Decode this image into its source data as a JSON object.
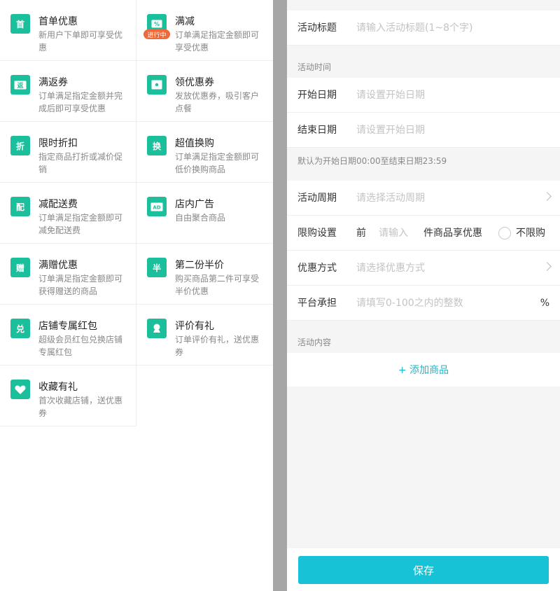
{
  "activities": [
    {
      "title": "首单优惠",
      "desc": "新用户下单即可享受优惠",
      "icon": "first-order-icon",
      "glyph": "首"
    },
    {
      "title": "满减",
      "desc": "订单满足指定金额即可享受优惠",
      "icon": "percent-tag-icon",
      "glyph": "%",
      "badge": "进行中"
    },
    {
      "title": "满返券",
      "desc": "订单满足指定金额并完成后即可享受优惠",
      "icon": "return-coupon-icon",
      "glyph": "返"
    },
    {
      "title": "领优惠券",
      "desc": "发放优惠券，吸引客户点餐",
      "icon": "coupon-icon",
      "glyph": "券"
    },
    {
      "title": "限时折扣",
      "desc": "指定商品打折或减价促销",
      "icon": "discount-icon",
      "glyph": "折"
    },
    {
      "title": "超值换购",
      "desc": "订单满足指定金额即可低价换购商品",
      "icon": "exchange-icon",
      "glyph": "换"
    },
    {
      "title": "减配送费",
      "desc": "订单满足指定金额即可减免配送费",
      "icon": "delivery-fee-icon",
      "glyph": "配"
    },
    {
      "title": "店内广告",
      "desc": "自由聚合商品",
      "icon": "ad-icon",
      "glyph": "AD"
    },
    {
      "title": "满赠优惠",
      "desc": "订单满足指定金额即可获得赠送的商品",
      "icon": "gift-icon",
      "glyph": "赠"
    },
    {
      "title": "第二份半价",
      "desc": "购买商品第二件可享受半价优惠",
      "icon": "half-price-icon",
      "glyph": "半"
    },
    {
      "title": "店铺专属红包",
      "desc": "超级会员红包兑换店铺专属红包",
      "icon": "red-packet-icon",
      "glyph": "兑"
    },
    {
      "title": "评价有礼",
      "desc": "订单评价有礼，送优惠券",
      "icon": "review-gift-icon",
      "glyph": ""
    },
    {
      "title": "收藏有礼",
      "desc": "首次收藏店铺，送优惠券",
      "icon": "heart-icon",
      "glyph": ""
    }
  ],
  "form": {
    "title_label": "活动标题",
    "title_placeholder": "请输入活动标题(1~8个字)",
    "time_section": "活动时间",
    "start_label": "开始日期",
    "start_placeholder": "请设置开始日期",
    "end_label": "结束日期",
    "end_placeholder": "请设置开始日期",
    "time_hint": "默认为开始日期00:00至结束日期23:59",
    "cycle_label": "活动周期",
    "cycle_placeholder": "请选择活动周期",
    "limit_label": "限购设置",
    "limit_prefix": "前",
    "limit_placeholder": "请输入",
    "limit_suffix": "件商品享优惠",
    "no_limit_label": "不限购",
    "discount_label": "优惠方式",
    "discount_placeholder": "请选择优惠方式",
    "platform_label": "平台承担",
    "platform_placeholder": "请填写0-100之内的整数",
    "platform_unit": "%",
    "content_section": "活动内容",
    "add_product": "+ 添加商品",
    "save": "保存"
  },
  "colors": {
    "accent_green": "#1bbf9b",
    "accent_cyan": "#17c2d6",
    "badge_orange": "#ef6a3a"
  }
}
